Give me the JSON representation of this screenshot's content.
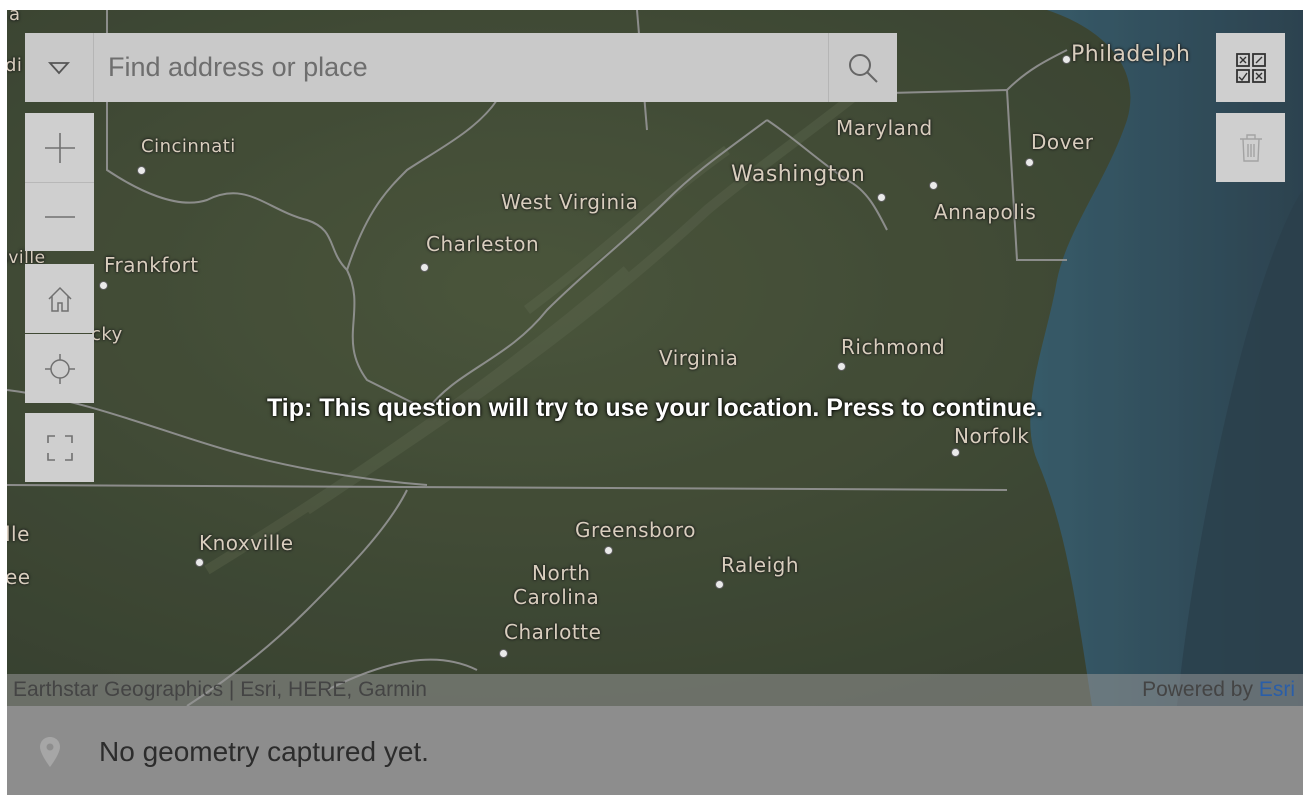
{
  "search": {
    "placeholder": "Find address or place"
  },
  "controls": {
    "dropdown_icon": "chevron-down-icon",
    "search_icon": "search-icon",
    "zoom_in_icon": "plus-icon",
    "zoom_out_icon": "minus-icon",
    "home_icon": "home-icon",
    "locate_icon": "crosshair-icon",
    "fullscreen_icon": "fullscreen-icon",
    "select_icon": "select-grid-icon",
    "delete_icon": "trash-icon"
  },
  "map_labels": {
    "philadelphia": "Philadelph",
    "cincinnati": "Cincinnati",
    "maryland": "Maryland",
    "dover": "Dover",
    "washington": "Washington",
    "west_virginia": "West Virginia",
    "annapolis": "Annapolis",
    "charleston": "Charleston",
    "frankfort": "Frankfort",
    "kentucky_fragment": "cky",
    "ville_fragment": "sville",
    "virginia": "Virginia",
    "richmond": "Richmond",
    "norfolk": "Norfolk",
    "knoxville": "Knoxville",
    "greensboro": "Greensboro",
    "north": "North",
    "carolina": "Carolina",
    "raleigh": "Raleigh",
    "charlotte": "Charlotte",
    "lle_fragment": "lle",
    "ee_fragment": "ee",
    "a_fragment": "a",
    "di_fragment": "di"
  },
  "tip": "Tip: This question will try to use your location. Press to continue.",
  "attribution": {
    "sources": "Earthstar Geographics | Esri, HERE, Garmin",
    "powered_by": "Powered by",
    "esri": "Esri"
  },
  "footer": {
    "pin_icon": "map-pin-icon",
    "message": "No geometry captured yet."
  },
  "colors": {
    "overlay": "#8a8a8a",
    "land": "#3a4a2c",
    "ocean": "#2a5568",
    "link": "#2a5ea8"
  }
}
